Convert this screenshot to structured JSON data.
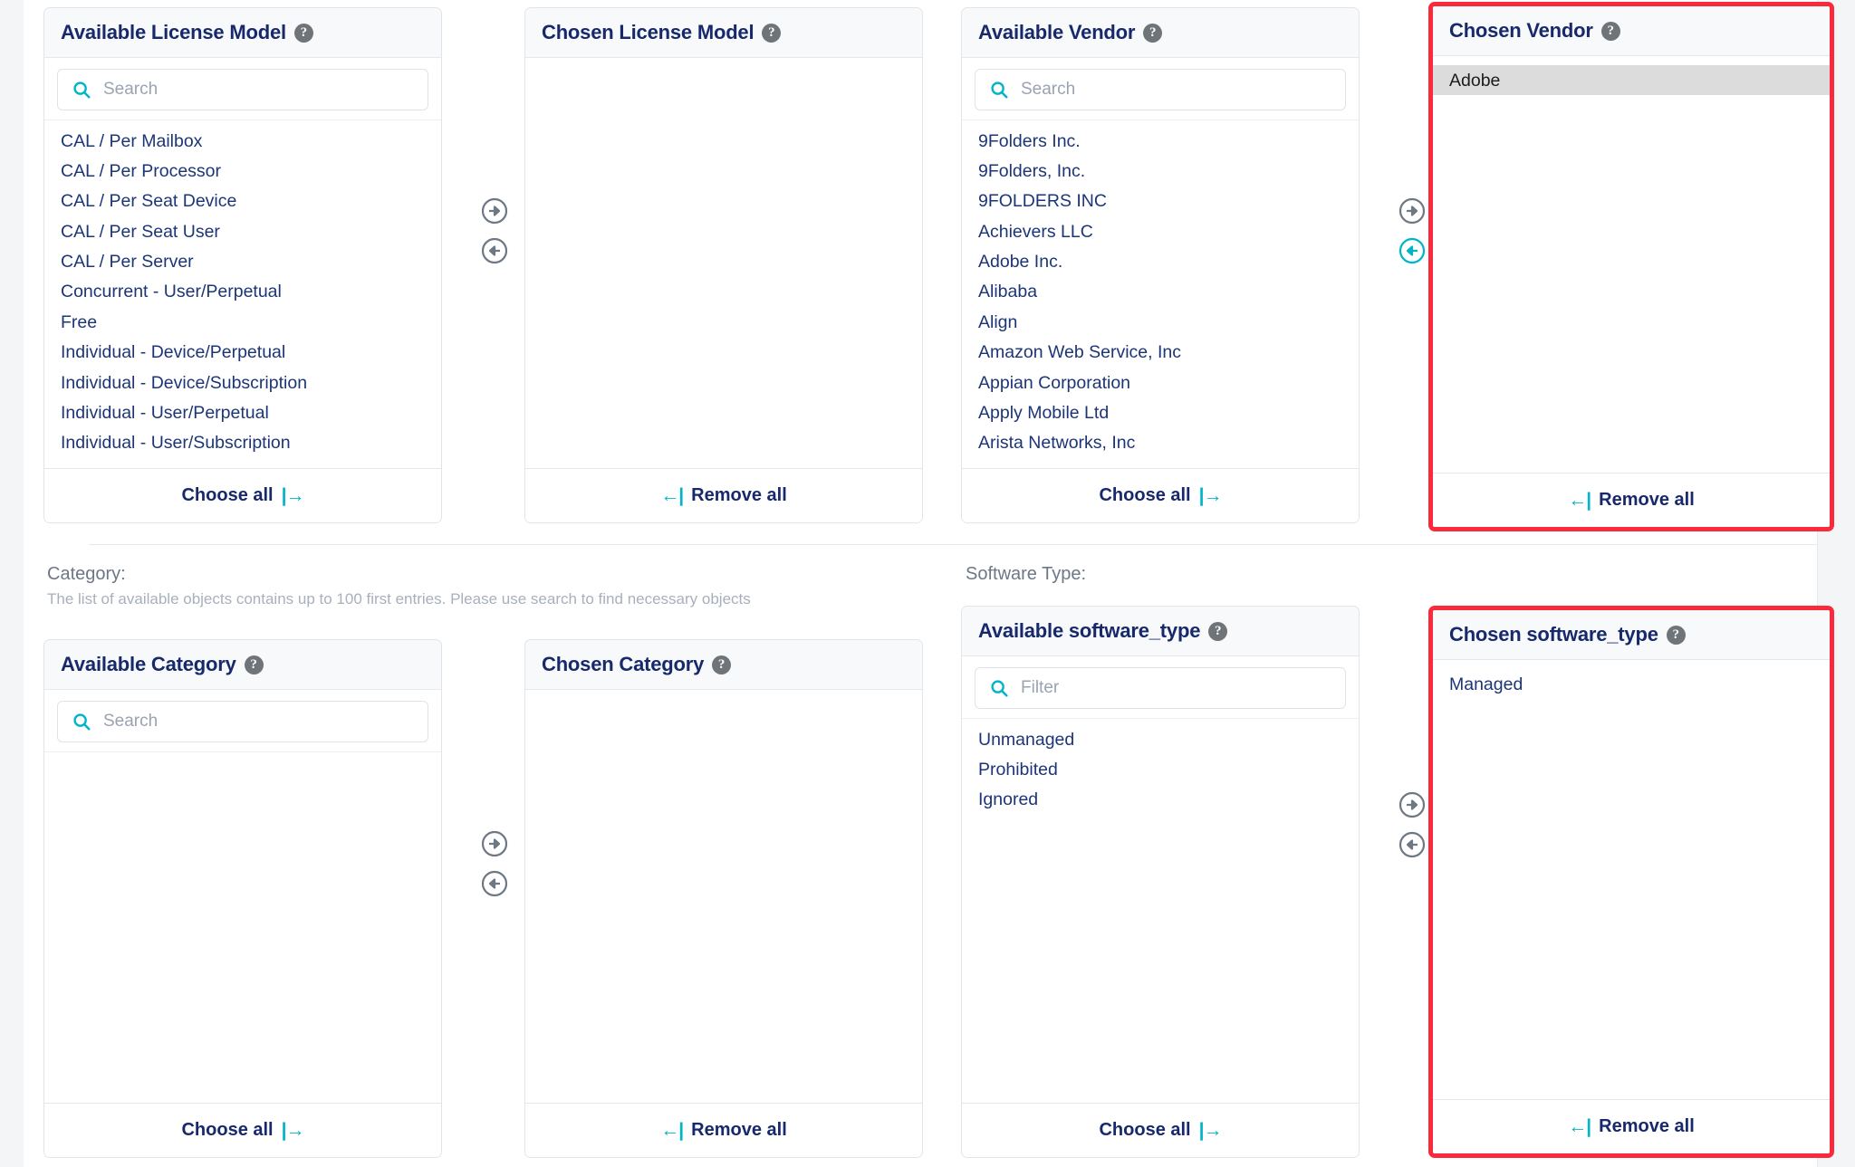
{
  "colors": {
    "brand_navy": "#17296b",
    "accent_teal": "#00b5c8",
    "highlight_red": "#fa2a3c",
    "selected_gray": "#dcdcdc",
    "panel_head_bg": "#f7f9fb",
    "muted_text": "#9aa3b2"
  },
  "labels": {
    "choose_all": "Choose all",
    "remove_all": "Remove all",
    "choose_all_glyph": "|→",
    "remove_all_glyph": "←|",
    "help_glyph": "?"
  },
  "section_license_vendor": {
    "available_license_model": {
      "title": "Available License Model",
      "search_placeholder": "Search",
      "search_value": "",
      "items": [
        "CAL / Per Mailbox",
        "CAL / Per Processor",
        "CAL / Per Seat Device",
        "CAL / Per Seat User",
        "CAL / Per Server",
        "Concurrent - User/Perpetual",
        "Free",
        "Individual - Device/Perpetual",
        "Individual - Device/Subscription",
        "Individual - User/Perpetual",
        "Individual - User/Subscription"
      ],
      "footer": "Choose all"
    },
    "chosen_license_model": {
      "title": "Chosen License Model",
      "items": [],
      "footer": "Remove all"
    },
    "available_vendor": {
      "title": "Available Vendor",
      "search_placeholder": "Search",
      "search_value": "",
      "items": [
        "9Folders Inc.",
        "9Folders, Inc.",
        "9FOLDERS INC",
        "Achievers LLC",
        "Adobe Inc.",
        "Alibaba",
        "Align",
        "Amazon Web Service, Inc",
        "Appian Corporation",
        "Apply Mobile Ltd",
        "Arista Networks, Inc"
      ],
      "footer": "Choose all"
    },
    "chosen_vendor": {
      "title": "Chosen Vendor",
      "items": [
        "Adobe"
      ],
      "selected_item": "Adobe",
      "footer": "Remove all",
      "highlighted": true
    }
  },
  "section_category_softwaretype": {
    "category_label": "Category:",
    "category_hint": "The list of available objects contains up to 100 first entries. Please use search to find necessary objects",
    "software_type_label": "Software Type:",
    "available_category": {
      "title": "Available Category",
      "search_placeholder": "Search",
      "search_value": "",
      "items": [],
      "footer": "Choose all"
    },
    "chosen_category": {
      "title": "Chosen Category",
      "items": [],
      "footer": "Remove all"
    },
    "available_software_type": {
      "title": "Available software_type",
      "search_placeholder": "Filter",
      "search_value": "",
      "items": [
        "Unmanaged",
        "Prohibited",
        "Ignored"
      ],
      "footer": "Choose all"
    },
    "chosen_software_type": {
      "title": "Chosen software_type",
      "items": [
        "Managed"
      ],
      "footer": "Remove all",
      "highlighted": true
    }
  }
}
